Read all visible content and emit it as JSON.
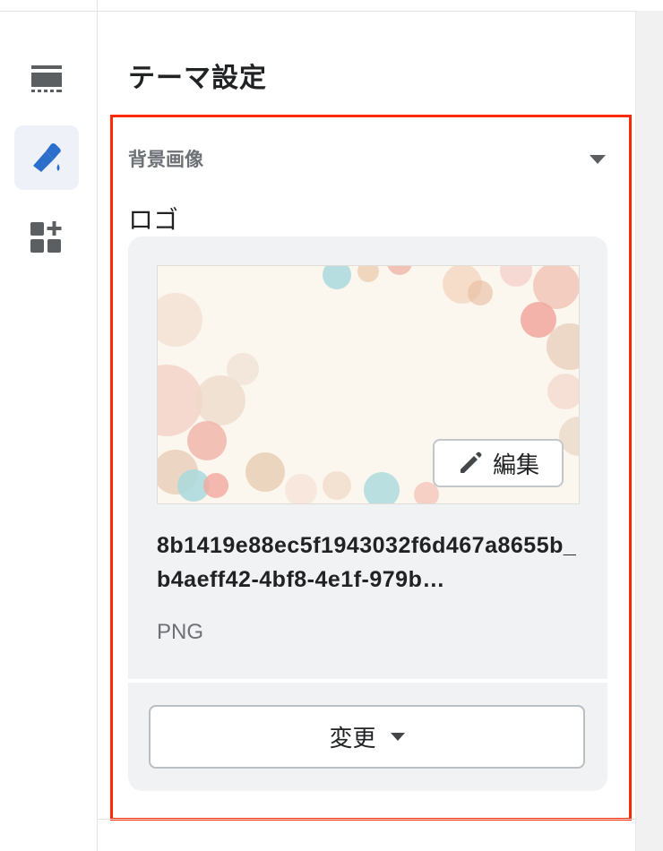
{
  "rail": {
    "items": [
      {
        "icon": "header-section-icon",
        "active": false
      },
      {
        "icon": "paint-brush-icon",
        "active": true
      },
      {
        "icon": "add-section-icon",
        "active": false
      }
    ]
  },
  "panel": {
    "title": "テーマ設定",
    "section_label": "背景画像",
    "logo_label": "ロゴ"
  },
  "image_card": {
    "edit_label": "編集",
    "filename": "8b1419e88ec5f1943032f6d467a8655b_b4aeff42-4bf8-4e1f-979b…",
    "file_type": "PNG",
    "change_label": "変更"
  },
  "colors": {
    "accent_blue": "#2c6ecb",
    "highlight_red": "#ff2a00"
  }
}
